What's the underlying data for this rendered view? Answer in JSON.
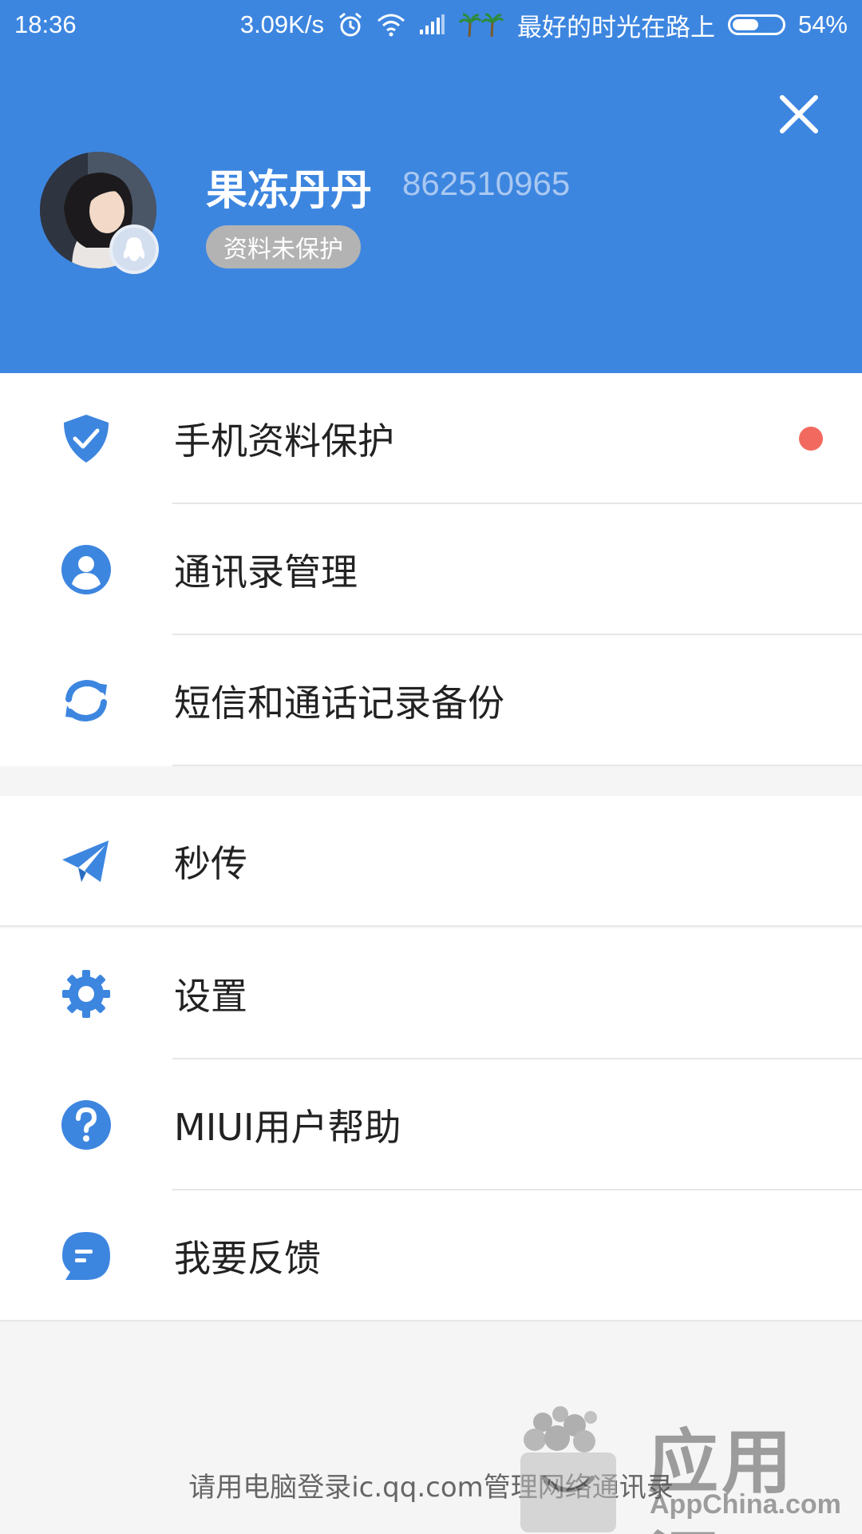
{
  "status_bar": {
    "time": "18:36",
    "speed": "3.09K/s",
    "carrier_text": "最好的时光在路上",
    "battery": "54%",
    "battery_level": 0.54
  },
  "header": {
    "user_name": "果冻丹丹",
    "user_id": "862510965",
    "protect_badge": "资料未保护",
    "background_color": "#3d86e0"
  },
  "menu": {
    "group1": [
      {
        "label": "手机资料保护",
        "icon": "shield-check-icon",
        "has_dot": true
      },
      {
        "label": "通讯录管理",
        "icon": "contact-person-icon"
      },
      {
        "label": "短信和通话记录备份",
        "icon": "sync-icon"
      }
    ],
    "group2": [
      {
        "label": "秒传",
        "icon": "paper-plane-icon"
      }
    ],
    "group3": [
      {
        "label": "设置",
        "icon": "gear-icon"
      },
      {
        "label": "MIUI用户帮助",
        "icon": "help-icon"
      },
      {
        "label": "我要反馈",
        "icon": "feedback-icon"
      }
    ]
  },
  "footer": {
    "text": "请用电脑登录ic.qq.com管理网络通讯录"
  },
  "watermark": {
    "cn": "应用汇",
    "en": "AppChina.com"
  },
  "colors": {
    "accent": "#3d86e0",
    "notification_dot": "#f26a5f"
  }
}
